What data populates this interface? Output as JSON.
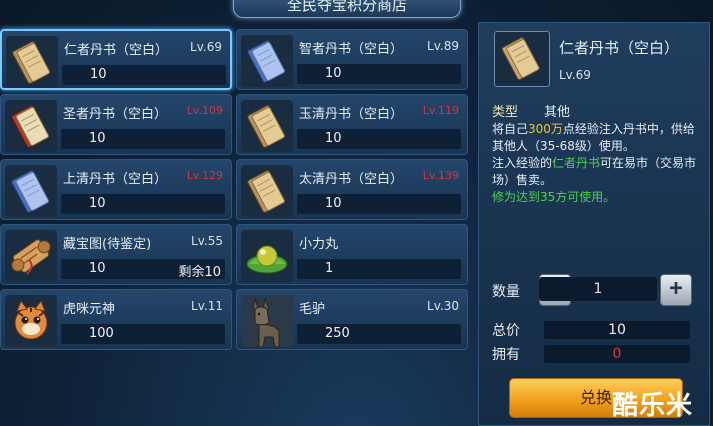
{
  "title": "全民夺宝积分商店",
  "items": [
    {
      "name": "仁者丹书（空白）",
      "level": "Lv.69",
      "price": "10",
      "remaining": "",
      "icon": "tan-scroll-icon",
      "selected": true,
      "level_red": false
    },
    {
      "name": "智者丹书（空白）",
      "level": "Lv.89",
      "price": "10",
      "remaining": "",
      "icon": "blue-scroll-icon",
      "selected": false,
      "level_red": false
    },
    {
      "name": "圣者丹书（空白）",
      "level": "Lv.109",
      "price": "10",
      "remaining": "",
      "icon": "red-scroll-icon",
      "selected": false,
      "level_red": true
    },
    {
      "name": "玉清丹书（空白）",
      "level": "Lv.119",
      "price": "10",
      "remaining": "",
      "icon": "tan-scroll-icon",
      "selected": false,
      "level_red": true
    },
    {
      "name": "上清丹书（空白）",
      "level": "Lv.129",
      "price": "10",
      "remaining": "",
      "icon": "blue-scroll-icon",
      "selected": false,
      "level_red": true
    },
    {
      "name": "太清丹书（空白）",
      "level": "Lv.139",
      "price": "10",
      "remaining": "",
      "icon": "tan-scroll-icon",
      "selected": false,
      "level_red": true
    },
    {
      "name": "藏宝图(待鉴定)",
      "level": "Lv.55",
      "price": "10",
      "remaining": "剩余10",
      "icon": "treasure-map-icon",
      "selected": false,
      "level_red": false
    },
    {
      "name": "小力丸",
      "level": "",
      "price": "1",
      "remaining": "",
      "icon": "pill-icon",
      "selected": false,
      "level_red": false
    },
    {
      "name": "虎咪元神",
      "level": "Lv.11",
      "price": "100",
      "remaining": "",
      "icon": "tiger-cub-icon",
      "selected": false,
      "level_red": false
    },
    {
      "name": "毛驴",
      "level": "Lv.30",
      "price": "250",
      "remaining": "",
      "icon": "donkey-icon",
      "selected": false,
      "level_red": false
    }
  ],
  "detail": {
    "name": "仁者丹书（空白）",
    "level": "Lv.69",
    "type_label": "类型",
    "type_value": "其他",
    "desc": {
      "p1": "将自己",
      "amount": "300万",
      "p2": "点经验注入丹书中，供给其他人（35-68级）使用。",
      "p3": "注入经验的",
      "item_link": "仁者丹书",
      "p4": "可在易市（交易市场）售卖。",
      "note": "修为达到35方可使用。"
    }
  },
  "purchase": {
    "qty_label": "数量",
    "qty": "1",
    "minus": "−",
    "plus": "+",
    "total_label": "总价",
    "total": "10",
    "own_label": "拥有",
    "own": "0",
    "button": "兑换"
  },
  "watermark": "酷乐米",
  "colors": {
    "level_red": "#d6343a",
    "gold": "#f2c32f",
    "green": "#4fcf54",
    "button": "#f0a11c",
    "owned_red": "#e53236"
  }
}
